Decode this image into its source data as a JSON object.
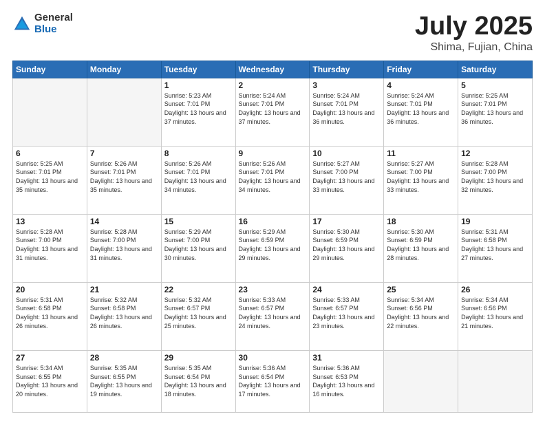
{
  "header": {
    "logo_general": "General",
    "logo_blue": "Blue",
    "title": "July 2025",
    "location": "Shima, Fujian, China"
  },
  "weekdays": [
    "Sunday",
    "Monday",
    "Tuesday",
    "Wednesday",
    "Thursday",
    "Friday",
    "Saturday"
  ],
  "weeks": [
    [
      {
        "num": "",
        "info": ""
      },
      {
        "num": "",
        "info": ""
      },
      {
        "num": "1",
        "info": "Sunrise: 5:23 AM\nSunset: 7:01 PM\nDaylight: 13 hours and 37 minutes."
      },
      {
        "num": "2",
        "info": "Sunrise: 5:24 AM\nSunset: 7:01 PM\nDaylight: 13 hours and 37 minutes."
      },
      {
        "num": "3",
        "info": "Sunrise: 5:24 AM\nSunset: 7:01 PM\nDaylight: 13 hours and 36 minutes."
      },
      {
        "num": "4",
        "info": "Sunrise: 5:24 AM\nSunset: 7:01 PM\nDaylight: 13 hours and 36 minutes."
      },
      {
        "num": "5",
        "info": "Sunrise: 5:25 AM\nSunset: 7:01 PM\nDaylight: 13 hours and 36 minutes."
      }
    ],
    [
      {
        "num": "6",
        "info": "Sunrise: 5:25 AM\nSunset: 7:01 PM\nDaylight: 13 hours and 35 minutes."
      },
      {
        "num": "7",
        "info": "Sunrise: 5:26 AM\nSunset: 7:01 PM\nDaylight: 13 hours and 35 minutes."
      },
      {
        "num": "8",
        "info": "Sunrise: 5:26 AM\nSunset: 7:01 PM\nDaylight: 13 hours and 34 minutes."
      },
      {
        "num": "9",
        "info": "Sunrise: 5:26 AM\nSunset: 7:01 PM\nDaylight: 13 hours and 34 minutes."
      },
      {
        "num": "10",
        "info": "Sunrise: 5:27 AM\nSunset: 7:00 PM\nDaylight: 13 hours and 33 minutes."
      },
      {
        "num": "11",
        "info": "Sunrise: 5:27 AM\nSunset: 7:00 PM\nDaylight: 13 hours and 33 minutes."
      },
      {
        "num": "12",
        "info": "Sunrise: 5:28 AM\nSunset: 7:00 PM\nDaylight: 13 hours and 32 minutes."
      }
    ],
    [
      {
        "num": "13",
        "info": "Sunrise: 5:28 AM\nSunset: 7:00 PM\nDaylight: 13 hours and 31 minutes."
      },
      {
        "num": "14",
        "info": "Sunrise: 5:28 AM\nSunset: 7:00 PM\nDaylight: 13 hours and 31 minutes."
      },
      {
        "num": "15",
        "info": "Sunrise: 5:29 AM\nSunset: 7:00 PM\nDaylight: 13 hours and 30 minutes."
      },
      {
        "num": "16",
        "info": "Sunrise: 5:29 AM\nSunset: 6:59 PM\nDaylight: 13 hours and 29 minutes."
      },
      {
        "num": "17",
        "info": "Sunrise: 5:30 AM\nSunset: 6:59 PM\nDaylight: 13 hours and 29 minutes."
      },
      {
        "num": "18",
        "info": "Sunrise: 5:30 AM\nSunset: 6:59 PM\nDaylight: 13 hours and 28 minutes."
      },
      {
        "num": "19",
        "info": "Sunrise: 5:31 AM\nSunset: 6:58 PM\nDaylight: 13 hours and 27 minutes."
      }
    ],
    [
      {
        "num": "20",
        "info": "Sunrise: 5:31 AM\nSunset: 6:58 PM\nDaylight: 13 hours and 26 minutes."
      },
      {
        "num": "21",
        "info": "Sunrise: 5:32 AM\nSunset: 6:58 PM\nDaylight: 13 hours and 26 minutes."
      },
      {
        "num": "22",
        "info": "Sunrise: 5:32 AM\nSunset: 6:57 PM\nDaylight: 13 hours and 25 minutes."
      },
      {
        "num": "23",
        "info": "Sunrise: 5:33 AM\nSunset: 6:57 PM\nDaylight: 13 hours and 24 minutes."
      },
      {
        "num": "24",
        "info": "Sunrise: 5:33 AM\nSunset: 6:57 PM\nDaylight: 13 hours and 23 minutes."
      },
      {
        "num": "25",
        "info": "Sunrise: 5:34 AM\nSunset: 6:56 PM\nDaylight: 13 hours and 22 minutes."
      },
      {
        "num": "26",
        "info": "Sunrise: 5:34 AM\nSunset: 6:56 PM\nDaylight: 13 hours and 21 minutes."
      }
    ],
    [
      {
        "num": "27",
        "info": "Sunrise: 5:34 AM\nSunset: 6:55 PM\nDaylight: 13 hours and 20 minutes."
      },
      {
        "num": "28",
        "info": "Sunrise: 5:35 AM\nSunset: 6:55 PM\nDaylight: 13 hours and 19 minutes."
      },
      {
        "num": "29",
        "info": "Sunrise: 5:35 AM\nSunset: 6:54 PM\nDaylight: 13 hours and 18 minutes."
      },
      {
        "num": "30",
        "info": "Sunrise: 5:36 AM\nSunset: 6:54 PM\nDaylight: 13 hours and 17 minutes."
      },
      {
        "num": "31",
        "info": "Sunrise: 5:36 AM\nSunset: 6:53 PM\nDaylight: 13 hours and 16 minutes."
      },
      {
        "num": "",
        "info": ""
      },
      {
        "num": "",
        "info": ""
      }
    ]
  ]
}
